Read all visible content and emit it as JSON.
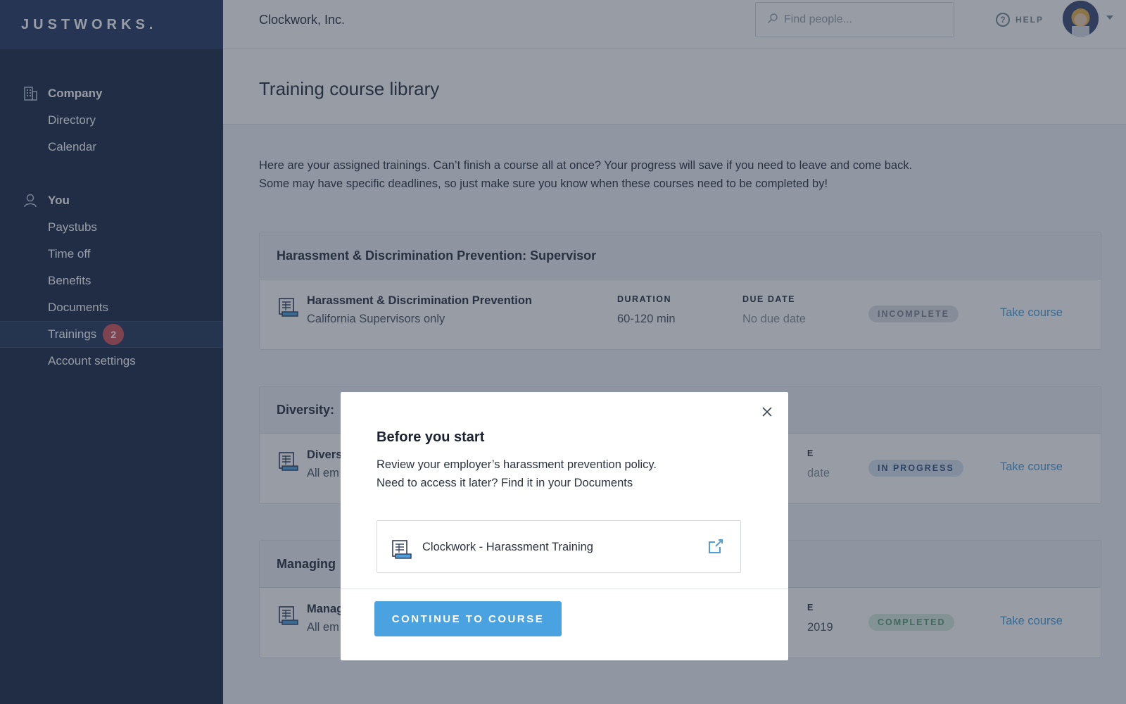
{
  "brand": {
    "logo": "JUSTWORKS."
  },
  "sidebar": {
    "sections": [
      {
        "label": "Company",
        "icon": "building-icon",
        "items": [
          {
            "label": "Directory"
          },
          {
            "label": "Calendar"
          }
        ]
      },
      {
        "label": "You",
        "icon": "person-icon",
        "items": [
          {
            "label": "Paystubs"
          },
          {
            "label": "Time off"
          },
          {
            "label": "Benefits"
          },
          {
            "label": "Documents"
          },
          {
            "label": "Trainings",
            "badge": "2",
            "active": true
          },
          {
            "label": "Account settings"
          }
        ]
      }
    ]
  },
  "topbar": {
    "company": "Clockwork, Inc.",
    "search_placeholder": "Find people...",
    "help": "HELP"
  },
  "page": {
    "title": "Training course library",
    "intro_line1": "Here are your assigned trainings. Can’t finish a course all at once? Your progress will save if you need to leave and come back.",
    "intro_line2": "Some may have specific deadlines, so just make sure you know when these courses need to be completed by!"
  },
  "courses": [
    {
      "group": "Harassment & Discrimination Prevention: Supervisor",
      "title": "Harassment & Discrimination Prevention",
      "subtitle": "California Supervisors only",
      "duration_label": "DURATION",
      "duration": "60-120 min",
      "due_label": "DUE DATE",
      "due": "No due date",
      "status": "INCOMPLETE",
      "action": "Take course"
    },
    {
      "group": "Diversity:",
      "title": "Divers",
      "subtitle": "All em",
      "due_label": "E",
      "due": "date",
      "status": "IN PROGRESS",
      "action": "Take course"
    },
    {
      "group": "Managing",
      "title": "Manag",
      "subtitle": "All em",
      "due_label": "E",
      "due": "2019",
      "status": "COMPLETED",
      "action": "Take course"
    }
  ],
  "modal": {
    "title": "Before you start",
    "line1": "Review your employer’s harassment prevention policy.",
    "line2": "Need to access it later? Find it in your Documents",
    "document": "Clockwork - Harassment Training",
    "button": "CONTINUE TO COURSE"
  },
  "colors": {
    "sidebar": "#1c2b48",
    "accent": "#4aa3e0",
    "badge": "#d2555a"
  }
}
